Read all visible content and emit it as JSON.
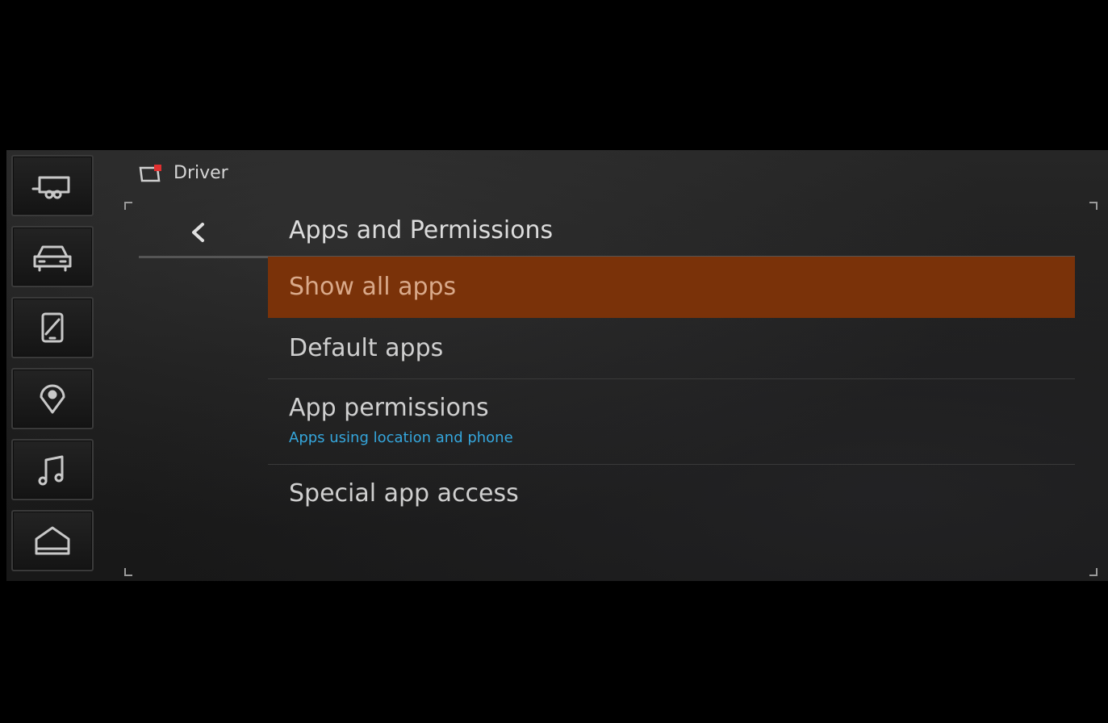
{
  "header": {
    "profile_name": "Driver"
  },
  "page": {
    "title": "Apps and Permissions"
  },
  "sidebar": {
    "items": [
      {
        "icon": "trailer-icon"
      },
      {
        "icon": "vehicle-icon"
      },
      {
        "icon": "phone-icon"
      },
      {
        "icon": "location-pin-icon"
      },
      {
        "icon": "music-note-icon"
      },
      {
        "icon": "home-icon"
      }
    ]
  },
  "list": {
    "items": [
      {
        "label": "Show all apps",
        "selected": true
      },
      {
        "label": "Default apps"
      },
      {
        "label": "App permissions",
        "subtitle": "Apps using location and phone"
      },
      {
        "label": "Special app access"
      }
    ]
  },
  "colors": {
    "selected_row": "#7a3209",
    "subtitle_text": "#35a6dc",
    "profile_badge": "#e03030",
    "background": "#1e1e1e"
  }
}
